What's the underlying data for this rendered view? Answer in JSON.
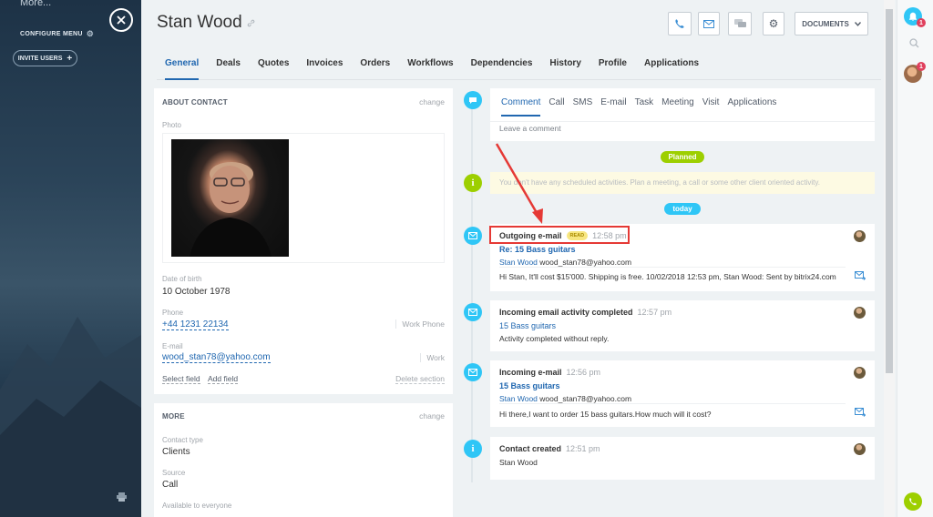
{
  "leftmenu": {
    "more": "More...",
    "configure": "CONFIGURE MENU",
    "invite": "INVITE USERS"
  },
  "contact": {
    "name": "Stan Wood"
  },
  "header": {
    "documents": "DOCUMENTS"
  },
  "tabs": [
    "General",
    "Deals",
    "Quotes",
    "Invoices",
    "Orders",
    "Workflows",
    "Dependencies",
    "History",
    "Profile",
    "Applications"
  ],
  "about": {
    "title": "ABOUT CONTACT",
    "change": "change",
    "photo_label": "Photo",
    "dob_label": "Date of birth",
    "dob": "10 October 1978",
    "phone_label": "Phone",
    "phone": "+44 1231 22134",
    "phone_type": "Work Phone",
    "email_label": "E-mail",
    "email": "wood_stan78@yahoo.com",
    "email_type": "Work",
    "select_field": "Select field",
    "add_field": "Add field",
    "delete_section": "Delete section"
  },
  "more": {
    "title": "MORE",
    "change": "change",
    "contact_type_label": "Contact type",
    "contact_type": "Clients",
    "source_label": "Source",
    "source": "Call",
    "available_label": "Available to everyone"
  },
  "composer": {
    "tabs": [
      "Comment",
      "Call",
      "SMS",
      "E-mail",
      "Task",
      "Meeting",
      "Visit",
      "Applications"
    ],
    "placeholder": "Leave a comment"
  },
  "planned": {
    "pill": "Planned",
    "text": "You don't have any scheduled activities. Plan a meeting, a call or some other client oriented activity."
  },
  "today": {
    "pill": "today"
  },
  "activities": [
    {
      "title": "Outgoing e-mail",
      "badge": "READ",
      "time": "12:58 pm",
      "subject": "Re: 15 Bass guitars",
      "from_name": "Stan Wood",
      "from_email": "wood_stan78@yahoo.com",
      "body": "Hi Stan, It'll cost $15'000. Shipping is free. 10/02/2018 12:53 pm, Stan Wood: Sent by bitrix24.com"
    },
    {
      "title": "Incoming email activity completed",
      "time": "12:57 pm",
      "subject": "15 Bass guitars",
      "body": "Activity completed without reply."
    },
    {
      "title": "Incoming e-mail",
      "time": "12:56 pm",
      "subject": "15 Bass guitars",
      "from_name": "Stan Wood",
      "from_email": "wood_stan78@yahoo.com",
      "body": "Hi there,I want to order 15 bass guitars.How much will it cost?"
    },
    {
      "title": "Contact created",
      "time": "12:51 pm",
      "body": "Stan Wood"
    }
  ],
  "notifications": {
    "bell_count": "1",
    "chat_count": "1"
  }
}
